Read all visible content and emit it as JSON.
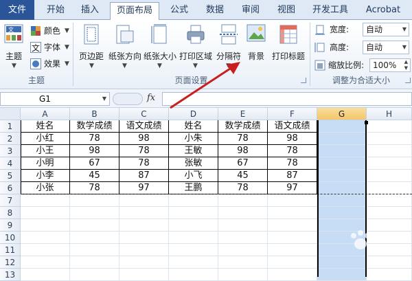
{
  "tabs": [
    "文件",
    "开始",
    "插入",
    "页面布局",
    "公式",
    "数据",
    "审阅",
    "视图",
    "开发工具",
    "Acrobat"
  ],
  "active_tab": "页面布局",
  "ribbon": {
    "theme_group": {
      "label": "主题",
      "theme_button": "主题",
      "colors": "颜色",
      "fonts": "字体",
      "effects": "效果"
    },
    "page_setup_group": {
      "label": "页面设置",
      "buttons": [
        "页边距",
        "纸张方向",
        "纸张大小",
        "打印区域",
        "分隔符",
        "背景",
        "打印标题"
      ]
    },
    "scale_group": {
      "label": "调整为合适大小",
      "width_label": "宽度:",
      "width_value": "自动",
      "height_label": "高度:",
      "height_value": "自动",
      "scale_label": "缩放比例:",
      "scale_value": "100%"
    }
  },
  "formula_bar": {
    "name_box": "G1",
    "fx": "fx",
    "value": ""
  },
  "columns": [
    "A",
    "B",
    "C",
    "D",
    "E",
    "F",
    "G",
    "H"
  ],
  "selected_column": "G",
  "rows": [
    "1",
    "2",
    "3",
    "4",
    "5",
    "6",
    "7",
    "8",
    "9",
    "10",
    "11",
    "12",
    "13"
  ],
  "table": [
    [
      "姓名",
      "数学成绩",
      "语文成绩",
      "姓名",
      "数学成绩",
      "语文成绩"
    ],
    [
      "小红",
      "78",
      "98",
      "小朱",
      "78",
      "98"
    ],
    [
      "小王",
      "98",
      "78",
      "王敏",
      "98",
      "78"
    ],
    [
      "小明",
      "67",
      "78",
      "张敏",
      "67",
      "78"
    ],
    [
      "小李",
      "45",
      "87",
      "小飞",
      "45",
      "87"
    ],
    [
      "小张",
      "78",
      "97",
      "王鹏",
      "78",
      "97"
    ]
  ],
  "colors": {
    "file_tab": "#2a5699",
    "selection": "#c6ddf5",
    "arrow": "#c81e1e"
  }
}
